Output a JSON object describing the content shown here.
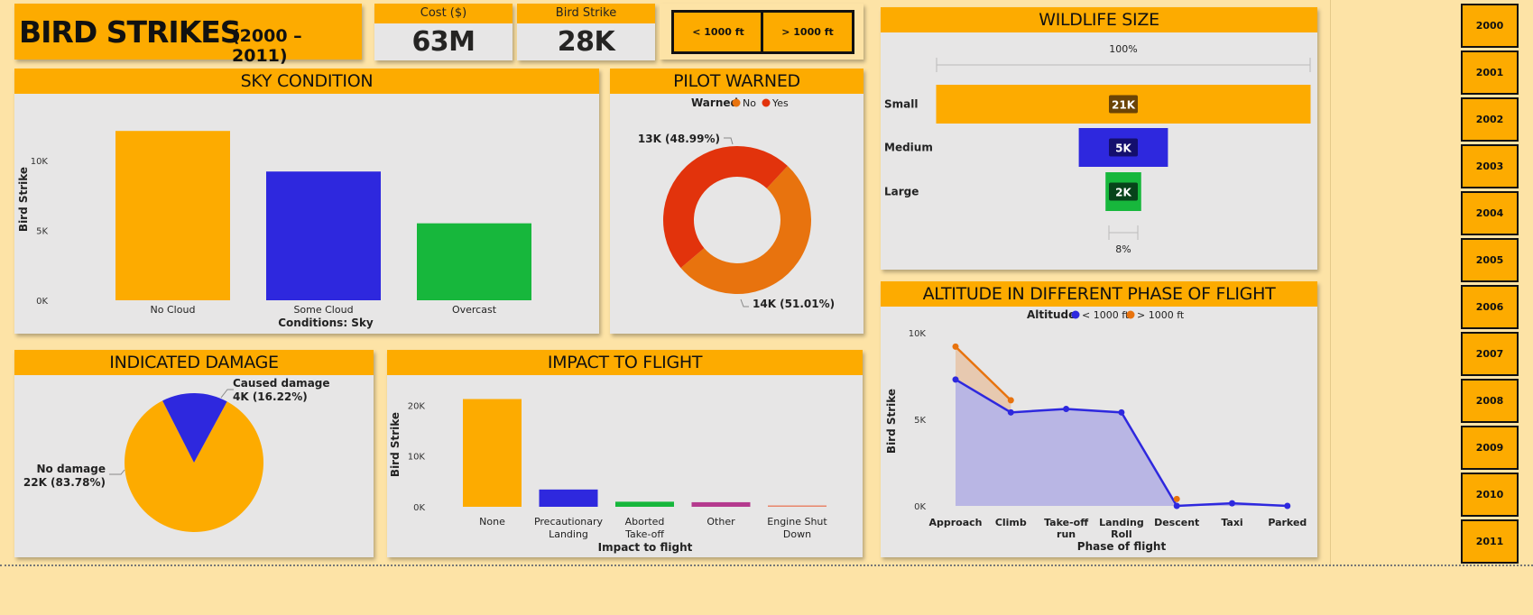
{
  "title": {
    "main": "BIRD STRIKES",
    "range": "(2000 – 2011)"
  },
  "kpis": [
    {
      "label": "Cost ($)",
      "value": "63M"
    },
    {
      "label": "Bird Strike",
      "value": "28K"
    }
  ],
  "altitude_slicer": {
    "options": [
      "< 1000 ft",
      "> 1000 ft"
    ]
  },
  "year_slicer": {
    "years": [
      "2000",
      "2001",
      "2002",
      "2003",
      "2004",
      "2005",
      "2006",
      "2007",
      "2008",
      "2009",
      "2010",
      "2011"
    ]
  },
  "colors": {
    "accent": "#fdab00",
    "blue": "#2e28de",
    "green": "#17b73c",
    "purple": "#b53a8e",
    "coral": "#e8856b",
    "orange_no": "#e8730e",
    "red_yes": "#e2330c",
    "panel": "#e7e6e6",
    "background": "#fde3a6"
  },
  "panels": {
    "sky": {
      "title": "SKY CONDITION"
    },
    "pilot": {
      "title": "PILOT WARNED"
    },
    "wildlife": {
      "title": "WILDLIFE SIZE"
    },
    "altitude": {
      "title": "ALTITUDE IN DIFFERENT PHASE OF FLIGHT"
    },
    "damage": {
      "title": "INDICATED DAMAGE"
    },
    "impact": {
      "title": "IMPACT TO FLIGHT"
    }
  },
  "chart_data": [
    {
      "id": "sky",
      "type": "bar",
      "categories": [
        "No Cloud",
        "Some Cloud",
        "Overcast"
      ],
      "values": [
        12100,
        9200,
        5500
      ],
      "colors": [
        "#fdab00",
        "#2e28de",
        "#17b73c"
      ],
      "xlabel": "Conditions: Sky",
      "ylabel": "Bird Strike",
      "yticks": [
        "0K",
        "5K",
        "10K"
      ],
      "ylim": [
        0,
        12500
      ],
      "grid": false
    },
    {
      "id": "pilot",
      "type": "pie",
      "donut": true,
      "legend_title": "Warned",
      "legend_position": "top-center",
      "slices": [
        {
          "name": "No",
          "value": 14000,
          "label": "14K (51.01%)",
          "color": "#e8730e"
        },
        {
          "name": "Yes",
          "value": 13000,
          "label": "13K (48.99%)",
          "color": "#e2330c"
        }
      ]
    },
    {
      "id": "wildlife",
      "type": "bar",
      "orientation": "funnel",
      "categories": [
        "Small",
        "Medium",
        "Large"
      ],
      "values": [
        21000,
        5000,
        2000
      ],
      "value_labels": [
        "21K",
        "5K",
        "2K"
      ],
      "colors": [
        "#fdab00",
        "#2e28de",
        "#17b73c"
      ],
      "label_colors": [
        "#6b4406",
        "#140f6d",
        "#07431a"
      ],
      "top_percent_label": "100%",
      "bottom_percent_label": "8%"
    },
    {
      "id": "altitude",
      "type": "area",
      "categories": [
        "Approach",
        "Climb",
        "Take-off run",
        "Landing Roll",
        "Descent",
        "Taxi",
        "Parked"
      ],
      "legend_title": "Altitude",
      "legend_position": "top-center",
      "series": [
        {
          "name": "< 1000 ft",
          "color": "#2e28de",
          "values": [
            7300,
            5400,
            5600,
            5400,
            0,
            150,
            0
          ]
        },
        {
          "name": "> 1000 ft",
          "color": "#e8730e",
          "values": [
            9200,
            6100,
            null,
            null,
            400,
            null,
            null
          ]
        }
      ],
      "xlabel": "Phase of flight",
      "ylabel": "Bird Strike",
      "yticks": [
        "0K",
        "5K",
        "10K"
      ],
      "ylim": [
        0,
        10000
      ],
      "grid": false
    },
    {
      "id": "damage",
      "type": "pie",
      "slices": [
        {
          "name": "No damage",
          "value": 22000,
          "label": "22K (83.78%)",
          "color": "#fdab00"
        },
        {
          "name": "Caused damage",
          "value": 4000,
          "label": "4K (16.22%)",
          "color": "#2e28de"
        }
      ]
    },
    {
      "id": "impact",
      "type": "bar",
      "categories": [
        "None",
        "Precautionary Landing",
        "Aborted Take-off",
        "Other",
        "Engine Shut Down"
      ],
      "values": [
        21200,
        3400,
        1000,
        900,
        150
      ],
      "colors": [
        "#fdab00",
        "#2e28de",
        "#17b73c",
        "#b53a8e",
        "#e8856b"
      ],
      "xlabel": "Impact to flight",
      "ylabel": "Bird Strike",
      "yticks": [
        "0K",
        "10K",
        "20K"
      ],
      "ylim": [
        0,
        22000
      ],
      "grid": false
    }
  ]
}
